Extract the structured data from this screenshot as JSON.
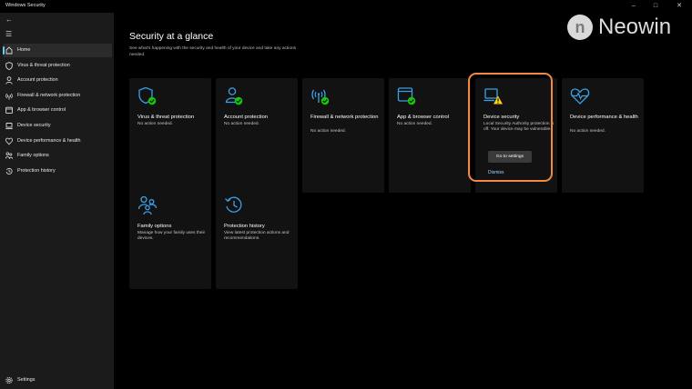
{
  "window": {
    "title": "Windows Security",
    "controls": {
      "minimize": "–",
      "maximize": "□",
      "close": "✕"
    }
  },
  "sidebar": {
    "back_icon": "←",
    "menu_icon": "☰",
    "items": [
      {
        "label": "Home",
        "icon": "home-icon",
        "selected": true
      },
      {
        "label": "Virus & threat protection",
        "icon": "shield-icon"
      },
      {
        "label": "Account protection",
        "icon": "person-icon"
      },
      {
        "label": "Firewall & network protection",
        "icon": "wifi-signal-icon"
      },
      {
        "label": "App & browser control",
        "icon": "app-window-icon"
      },
      {
        "label": "Device security",
        "icon": "laptop-icon"
      },
      {
        "label": "Device performance & health",
        "icon": "heart-pulse-icon"
      },
      {
        "label": "Family options",
        "icon": "family-icon"
      },
      {
        "label": "Protection history",
        "icon": "history-icon"
      }
    ],
    "settings": {
      "label": "Settings",
      "icon": "gear-icon"
    }
  },
  "main": {
    "title": "Security at a glance",
    "subtitle": "See what's happening with the security and health of your device and take any actions needed.",
    "cards": [
      {
        "title": "Virus & threat protection",
        "status": "No action needed.",
        "icon": "shield-check-icon"
      },
      {
        "title": "Account protection",
        "status": "No action needed.",
        "icon": "person-check-icon"
      },
      {
        "title": "Firewall & network protection",
        "status": "No action needed.",
        "icon": "wifi-check-icon"
      },
      {
        "title": "App & browser control",
        "status": "No action needed.",
        "icon": "app-window-check-icon"
      },
      {
        "title": "Device security",
        "status": "Local Security Authority protection is off. Your device may be vulnerable.",
        "icon": "laptop-warning-icon",
        "button": "Go to settings",
        "link": "Dismiss"
      },
      {
        "title": "Device performance & health",
        "status": "No action needed.",
        "icon": "heart-pulse-icon"
      },
      {
        "title": "Family options",
        "status": "Manage how your family uses their devices.",
        "icon": "family-icon"
      },
      {
        "title": "Protection history",
        "status": "View latest protection actions and recommendations.",
        "icon": "history-icon"
      }
    ]
  },
  "watermark": {
    "text": "Neowin",
    "logo_letter": "n"
  },
  "colors": {
    "accent": "#60cdff",
    "ok_green": "#16c60c",
    "warning": "#fcd116",
    "highlight": "#ef8a44"
  }
}
